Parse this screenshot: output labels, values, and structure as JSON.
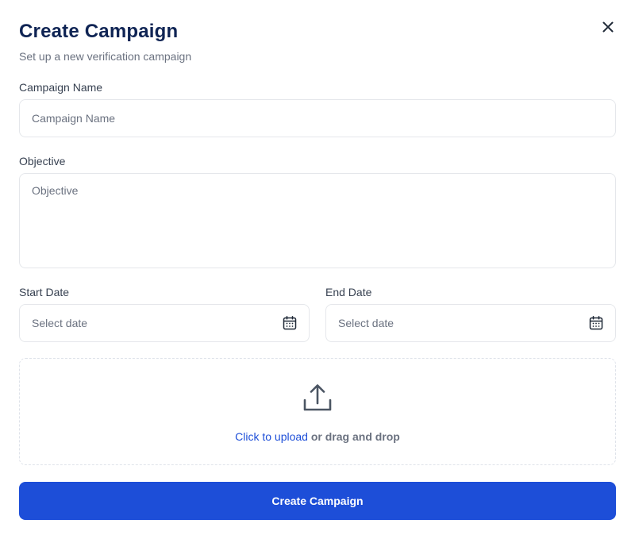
{
  "header": {
    "title": "Create Campaign",
    "subtitle": "Set up a new verification campaign",
    "close_icon": "close-icon"
  },
  "form": {
    "campaign_name": {
      "label": "Campaign Name",
      "placeholder": "Campaign Name",
      "value": ""
    },
    "objective": {
      "label": "Objective",
      "placeholder": "Objective",
      "value": ""
    },
    "start_date": {
      "label": "Start Date",
      "placeholder": "Select date",
      "icon": "calendar-icon"
    },
    "end_date": {
      "label": "End Date",
      "placeholder": "Select date",
      "icon": "calendar-icon"
    }
  },
  "upload": {
    "icon": "upload-icon",
    "link_text": "Click to upload",
    "rest_text": " or drag and drop"
  },
  "actions": {
    "submit_label": "Create Campaign"
  },
  "colors": {
    "title": "#0f2454",
    "primary": "#1d4ed8",
    "border": "#e5e7eb",
    "muted_text": "#6b7280"
  }
}
